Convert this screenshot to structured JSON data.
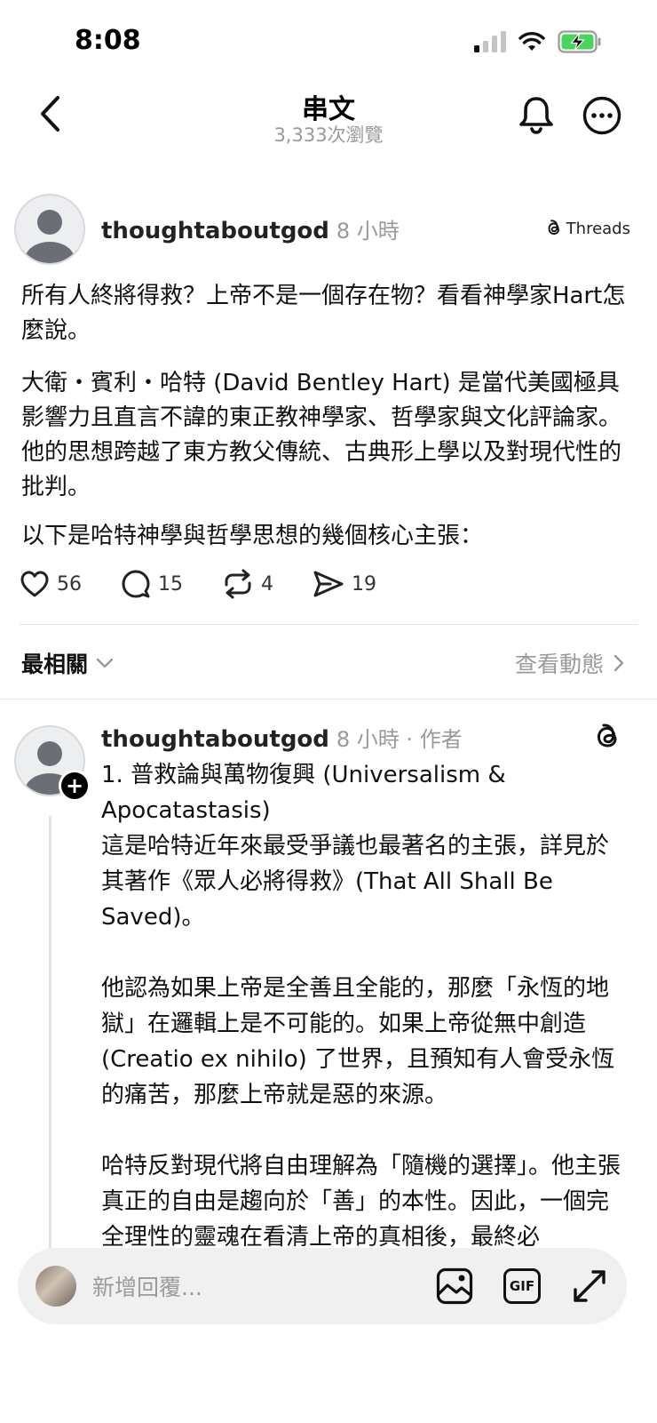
{
  "status_bar": {
    "time": "8:08"
  },
  "header": {
    "title": "串文",
    "subtitle": "3,333次瀏覽"
  },
  "post": {
    "username": "thoughtaboutgod",
    "time": "8 小時",
    "source_badge": "Threads",
    "paragraphs": [
      "所有人終將得救？上帝不是一個存在物？看看神學家Hart怎麼說。",
      "大衛・賓利・哈特 (David Bentley Hart) 是當代美國極具影響力且直言不諱的東正教神學家、哲學家與文化評論家。他的思想跨越了東方教父傳統、古典形上學以及對現代性的批判。",
      "以下是哈特神學與哲學思想的幾個核心主張："
    ],
    "stats": {
      "likes": "56",
      "comments": "15",
      "reposts": "4",
      "shares": "19"
    }
  },
  "sort": {
    "label": "最相關",
    "view_activity": "查看動態"
  },
  "reply": {
    "username": "thoughtaboutgod",
    "meta": "8 小時 · 作者",
    "paragraphs": [
      "1. 普救論與萬物復興 (Universalism & Apocatastasis)",
      "這是哈特近年來最受爭議也最著名的主張，詳見於其著作《眾人必將得救》(That All Shall Be Saved)。",
      "他認為如果上帝是全善且全能的，那麼「永恆的地獄」在邏輯上是不可能的。如果上帝從無中創造 (Creatio ex nihilo) 了世界，且預知有人會受永恆的痛苦，那麼上帝就是惡的來源。",
      "哈特反對現代將自由理解為「隨機的選擇」。他主張真正的自由是趨向於「善」的本性。因此，一個完全理性的靈魂在看清上帝的真相後，最終必"
    ]
  },
  "compose": {
    "placeholder": "新增回覆...",
    "gif_label": "GIF"
  }
}
